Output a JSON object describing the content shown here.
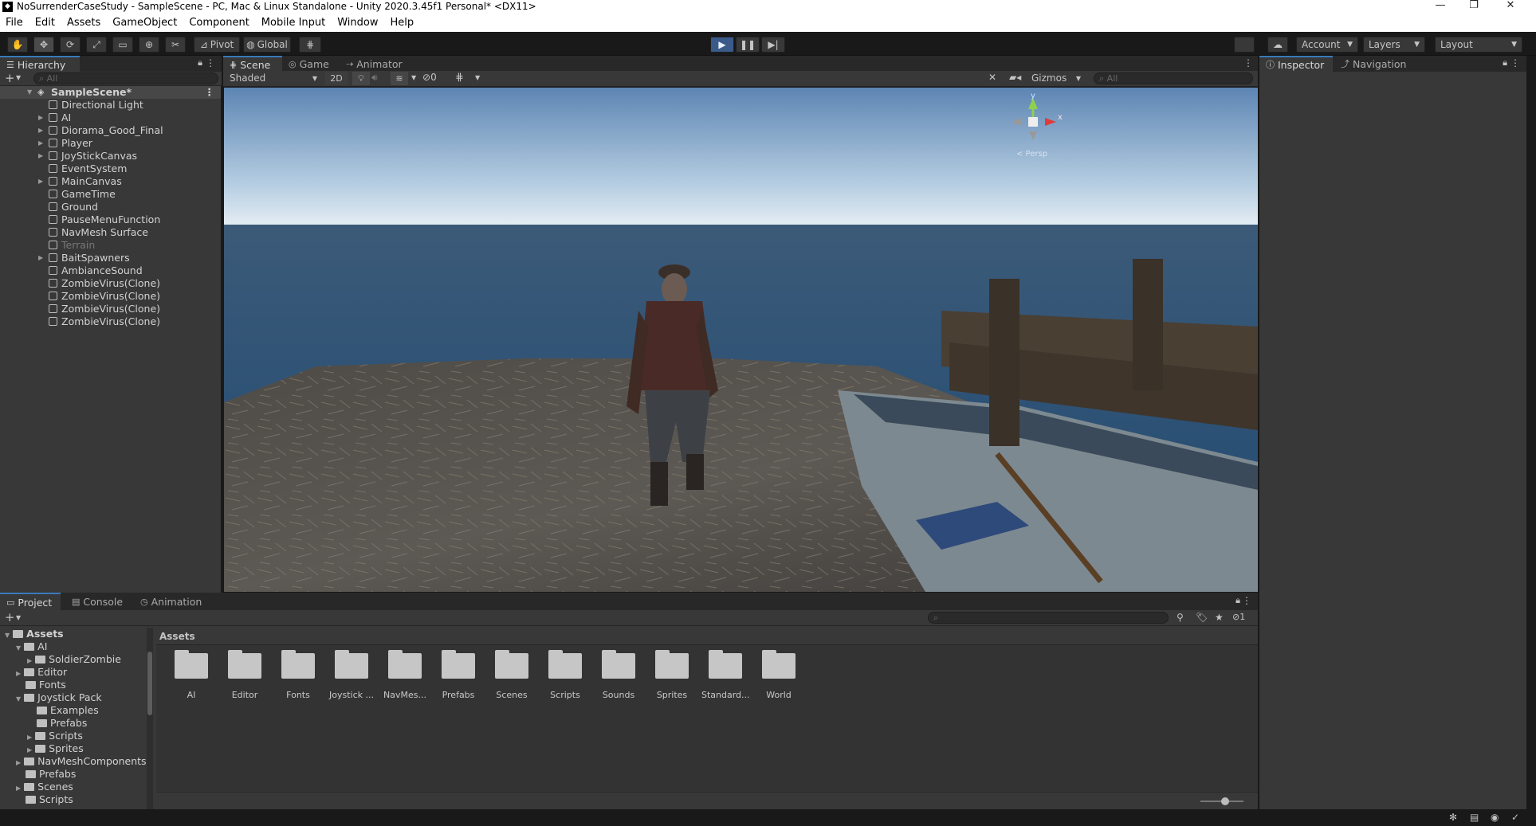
{
  "window": {
    "title": "NoSurrenderCaseStudy - SampleScene - PC, Mac & Linux Standalone - Unity 2020.3.45f1 Personal* <DX11>",
    "controls": [
      "—",
      "❐",
      "✕"
    ]
  },
  "menu": [
    "File",
    "Edit",
    "Assets",
    "GameObject",
    "Component",
    "Mobile Input",
    "Window",
    "Help"
  ],
  "toolbar": {
    "pivot": "Pivot",
    "global": "Global",
    "account": "Account",
    "layers": "Layers",
    "layout": "Layout"
  },
  "hierarchy": {
    "tab": "Hierarchy",
    "search_placeholder": "All",
    "scene": "SampleScene*",
    "items": [
      {
        "label": "Directional Light",
        "expand": false,
        "dim": false
      },
      {
        "label": "AI",
        "expand": true,
        "dim": false
      },
      {
        "label": "Diorama_Good_Final",
        "expand": true,
        "dim": false
      },
      {
        "label": "Player",
        "expand": true,
        "dim": false
      },
      {
        "label": "JoyStickCanvas",
        "expand": true,
        "dim": false
      },
      {
        "label": "EventSystem",
        "expand": false,
        "dim": false
      },
      {
        "label": "MainCanvas",
        "expand": true,
        "dim": false
      },
      {
        "label": "GameTime",
        "expand": false,
        "dim": false
      },
      {
        "label": "Ground",
        "expand": false,
        "dim": false
      },
      {
        "label": "PauseMenuFunction",
        "expand": false,
        "dim": false
      },
      {
        "label": "NavMesh Surface",
        "expand": false,
        "dim": false
      },
      {
        "label": "Terrain",
        "expand": false,
        "dim": true
      },
      {
        "label": "BaitSpawners",
        "expand": true,
        "dim": false
      },
      {
        "label": "AmbianceSound",
        "expand": false,
        "dim": false
      },
      {
        "label": "ZombieVirus(Clone)",
        "expand": false,
        "dim": false
      },
      {
        "label": "ZombieVirus(Clone)",
        "expand": false,
        "dim": false
      },
      {
        "label": "ZombieVirus(Clone)",
        "expand": false,
        "dim": false
      },
      {
        "label": "ZombieVirus(Clone)",
        "expand": false,
        "dim": false
      }
    ]
  },
  "scene": {
    "tabs": [
      "Scene",
      "Game",
      "Animator"
    ],
    "shading": "Shaded",
    "mode2d": "2D",
    "hidden_count": "0",
    "gizmos": "Gizmos",
    "search_placeholder": "All",
    "gizmo_y": "y",
    "gizmo_x": "x",
    "persp": "< Persp"
  },
  "inspector": {
    "tabs": [
      "Inspector",
      "Navigation"
    ]
  },
  "project": {
    "tabs": [
      "Project",
      "Console",
      "Animation"
    ],
    "breadcrumb": "Assets",
    "count": "1",
    "tree": [
      {
        "label": "Assets",
        "depth": 0,
        "open": true,
        "bold": true
      },
      {
        "label": "AI",
        "depth": 1,
        "open": true
      },
      {
        "label": "SoldierZombie",
        "depth": 2,
        "arrow": true
      },
      {
        "label": "Editor",
        "depth": 1,
        "arrow": true
      },
      {
        "label": "Fonts",
        "depth": 1
      },
      {
        "label": "Joystick Pack",
        "depth": 1,
        "open": true
      },
      {
        "label": "Examples",
        "depth": 2
      },
      {
        "label": "Prefabs",
        "depth": 2
      },
      {
        "label": "Scripts",
        "depth": 2,
        "arrow": true
      },
      {
        "label": "Sprites",
        "depth": 2,
        "arrow": true
      },
      {
        "label": "NavMeshComponents-i",
        "depth": 1,
        "arrow": true
      },
      {
        "label": "Prefabs",
        "depth": 1
      },
      {
        "label": "Scenes",
        "depth": 1,
        "arrow": true
      },
      {
        "label": "Scripts",
        "depth": 1
      }
    ],
    "assets": [
      "AI",
      "Editor",
      "Fonts",
      "Joystick ...",
      "NavMes...",
      "Prefabs",
      "Scenes",
      "Scripts",
      "Sounds",
      "Sprites",
      "Standard...",
      "World"
    ]
  },
  "colors": {
    "accent": "#3a79bb",
    "panel": "#383838",
    "dark": "#191919"
  }
}
